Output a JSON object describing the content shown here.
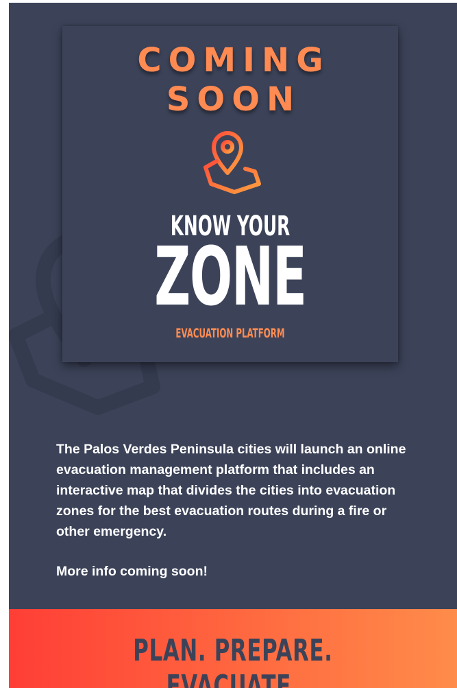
{
  "card": {
    "coming_line1": "COMING",
    "coming_line2": "SOON",
    "icon": "map-pin-icon",
    "know_your": "KNOW YOUR",
    "zone": "ZONE",
    "platform": "EVACUATION PLATFORM"
  },
  "content": {
    "description": "The Palos Verdes Peninsula cities will launch an online evacuation management platform that includes an interactive map that divides the cities into evacuation zones for the best evacuation routes during a fire or other emergency.",
    "more_info": "More info coming soon!"
  },
  "banner": {
    "tagline": "PLAN. PREPARE. EVACUATE."
  },
  "colors": {
    "background": "#3c4359",
    "accent_orange": "#ff8a52",
    "banner_start": "#ff3e36",
    "banner_end": "#ff8c4a"
  }
}
